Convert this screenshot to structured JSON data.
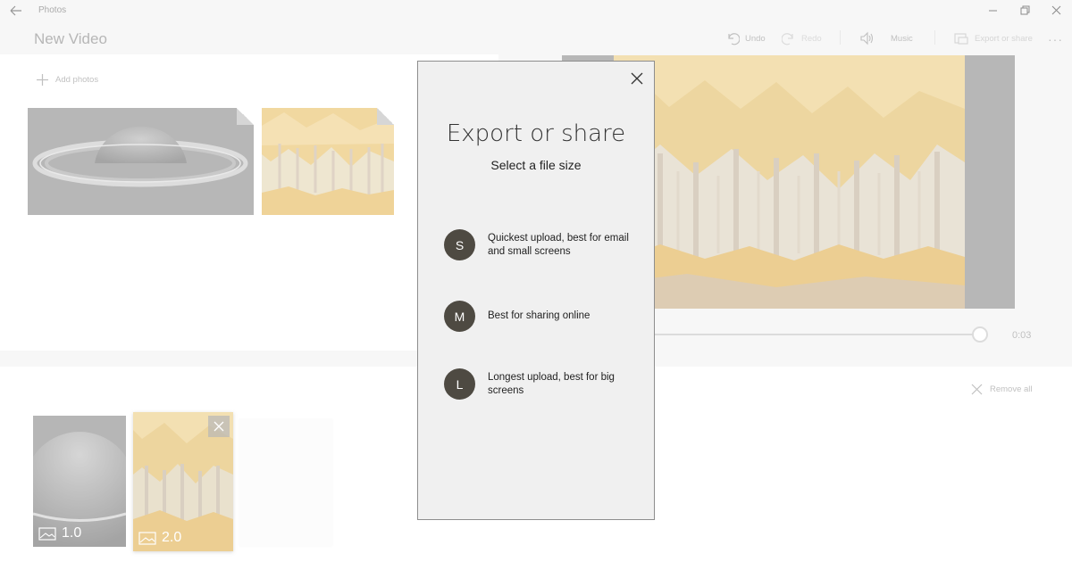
{
  "app": {
    "title": "Photos"
  },
  "project": {
    "title": "New Video"
  },
  "toolbar": {
    "undo_label": "Undo",
    "redo_label": "Redo",
    "music_label": "Music",
    "export_label": "Export or share",
    "more_label": "···"
  },
  "library": {
    "add_photos_label": "Add photos"
  },
  "preview": {
    "time": "0:03",
    "progress": 1.0
  },
  "storyboard": {
    "remove_all_label": "Remove all",
    "cards": [
      {
        "duration": "1.0"
      },
      {
        "duration": "2.0"
      }
    ]
  },
  "dialog": {
    "title": "Export or share",
    "subtitle": "Select a file size",
    "options": [
      {
        "letter": "S",
        "text": "Quickest upload, best for email and small screens"
      },
      {
        "letter": "M",
        "text": "Best for sharing online"
      },
      {
        "letter": "L",
        "text": "Longest upload, best for big screens"
      }
    ]
  },
  "colors": {
    "option_circle": "#4e4a42",
    "dialog_bg": "#f0f0f0"
  },
  "icons": {
    "back": "back-arrow-icon",
    "minimize": "minimize-icon",
    "maximize": "restore-icon",
    "close": "close-icon",
    "undo": "undo-icon",
    "redo": "redo-icon",
    "music": "speaker-icon",
    "export": "export-icon",
    "add": "plus-icon",
    "remove": "x-icon",
    "image": "image-icon"
  }
}
